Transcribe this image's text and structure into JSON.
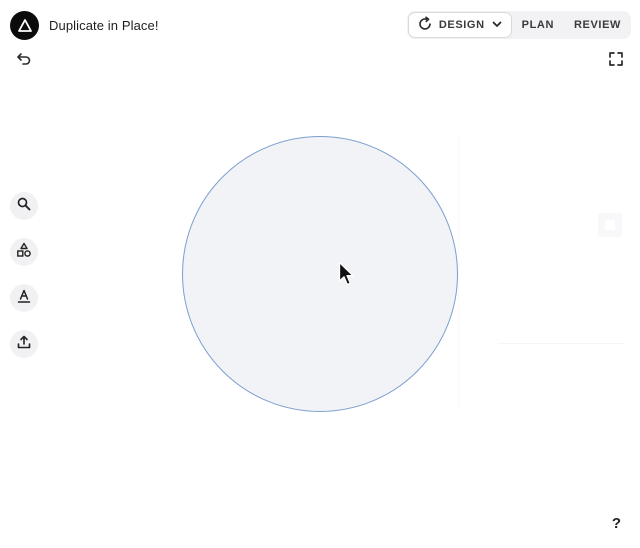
{
  "header": {
    "title": "Duplicate in Place!",
    "logo_icon": "triangle-logo-icon"
  },
  "modes": {
    "active": {
      "label": "DESIGN",
      "icon": "refresh-icon",
      "dropdown_icon": "chevron-down-icon"
    },
    "tabs": [
      {
        "label": "PLAN"
      },
      {
        "label": "REVIEW"
      }
    ]
  },
  "toolbar": {
    "undo_icon": "undo-icon",
    "fullscreen_icon": "fullscreen-icon",
    "help_label": "?"
  },
  "tools": [
    {
      "name": "search",
      "icon": "search-icon"
    },
    {
      "name": "shapes",
      "icon": "shapes-icon"
    },
    {
      "name": "text",
      "icon": "text-icon"
    },
    {
      "name": "upload",
      "icon": "upload-icon"
    }
  ],
  "canvas": {
    "shape": "circle",
    "fill": "#f1f3f6",
    "stroke": "#7d9fd0"
  },
  "colors": {
    "background": "#ffffff",
    "logo": "#0b0b0b",
    "tool_bg": "#f1f1f3",
    "accent_stroke": "#7d9fd0"
  }
}
